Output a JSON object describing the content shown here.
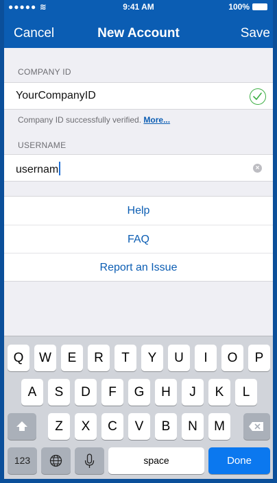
{
  "status_bar": {
    "signal": "●●●●● ≋",
    "time": "9:41 AM",
    "battery": "100%"
  },
  "nav": {
    "cancel": "Cancel",
    "title": "New Account",
    "save": "Save"
  },
  "company": {
    "label": "COMPANY ID",
    "value": "YourCompanyID",
    "note_text": "Company ID successfully verified.",
    "note_link": "More..."
  },
  "username": {
    "label": "USERNAME",
    "value": "usernam"
  },
  "links": [
    "Help",
    "FAQ",
    "Report an Issue"
  ],
  "keyboard": {
    "row1": [
      "Q",
      "W",
      "E",
      "R",
      "T",
      "Y",
      "U",
      "I",
      "O",
      "P"
    ],
    "row2": [
      "A",
      "S",
      "D",
      "F",
      "G",
      "H",
      "J",
      "K",
      "L"
    ],
    "row3": [
      "Z",
      "X",
      "C",
      "V",
      "B",
      "N",
      "M"
    ],
    "numbers": "123",
    "space": "space",
    "done": "Done"
  },
  "colors": {
    "nav_background": "#0b5db3",
    "verified": "#3cae43",
    "done_key": "#0b78ef"
  }
}
